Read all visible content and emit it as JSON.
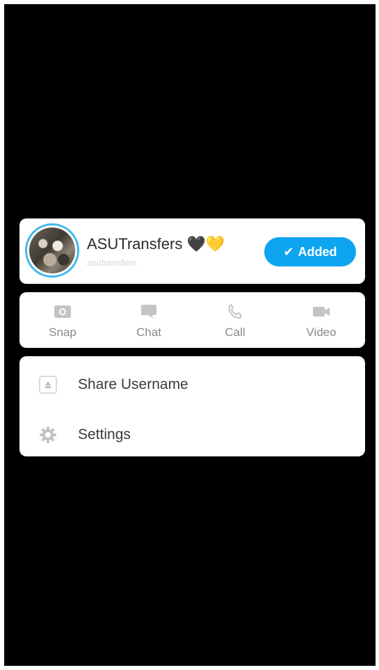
{
  "profile": {
    "display_name": "ASUTransfers 🖤💛",
    "username": "asutransfers",
    "added_label": "Added",
    "added_check": "✔"
  },
  "actions": [
    {
      "label": "Snap",
      "icon": "camera-icon"
    },
    {
      "label": "Chat",
      "icon": "chat-bubble-icon"
    },
    {
      "label": "Call",
      "icon": "phone-icon"
    },
    {
      "label": "Video",
      "icon": "video-camera-icon"
    }
  ],
  "menu": [
    {
      "label": "Share Username",
      "icon": "share-icon"
    },
    {
      "label": "Settings",
      "icon": "gear-icon"
    }
  ],
  "colors": {
    "accent": "#0ea5f0",
    "avatar_ring": "#41b7ec",
    "background": "#000000",
    "card": "#ffffff"
  }
}
